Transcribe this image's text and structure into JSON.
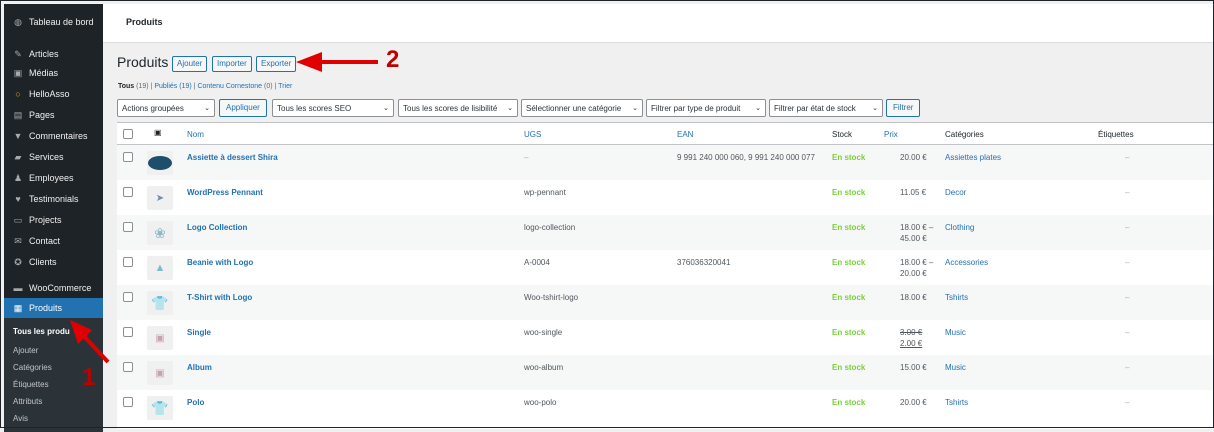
{
  "sidebar": {
    "items": [
      {
        "label": "Tableau de bord",
        "icon": "dashboard-icon"
      },
      {
        "label": "Articles",
        "icon": "pin-icon"
      },
      {
        "label": "Médias",
        "icon": "media-icon"
      },
      {
        "label": "HelloAsso",
        "icon": "helloasso-icon"
      },
      {
        "label": "Pages",
        "icon": "pages-icon"
      },
      {
        "label": "Commentaires",
        "icon": "comments-icon"
      },
      {
        "label": "Services",
        "icon": "services-icon"
      },
      {
        "label": "Employees",
        "icon": "employees-icon"
      },
      {
        "label": "Testimonials",
        "icon": "heart-icon"
      },
      {
        "label": "Projects",
        "icon": "projects-icon"
      },
      {
        "label": "Contact",
        "icon": "mail-icon"
      },
      {
        "label": "Clients",
        "icon": "clients-icon"
      },
      {
        "label": "WooCommerce",
        "icon": "woocommerce-icon"
      },
      {
        "label": "Produits",
        "icon": "archive-icon"
      }
    ],
    "submenu": [
      {
        "label": "Tous les produ"
      },
      {
        "label": "Ajouter"
      },
      {
        "label": "Catégories"
      },
      {
        "label": "Étiquettes"
      },
      {
        "label": "Attributs"
      },
      {
        "label": "Avis"
      }
    ]
  },
  "topbar": {
    "title": "Produits"
  },
  "heading": {
    "title": "Produits",
    "add_label": "Ajouter",
    "import_label": "Importer",
    "export_label": "Exporter"
  },
  "views": {
    "all": "Tous",
    "all_count": "(19)",
    "sep1": "|",
    "published": "Publiés (19)",
    "sep2": "|",
    "cornerstone": "Contenu Cornestone",
    "cornerstone_count": "(0)",
    "sep3": "|",
    "sort": "Trier"
  },
  "filters": {
    "bulk_actions": "Actions groupées",
    "apply": "Appliquer",
    "seo": "Tous les scores SEO",
    "readability": "Tous les scores de lisibilité",
    "category": "Sélectionner une catégorie",
    "product_type": "Filtrer par type de produit",
    "stock_status": "Filtrer par état de stock",
    "filter_button": "Filtrer"
  },
  "table": {
    "columns": {
      "name": "Nom",
      "sku": "UGS",
      "ean": "EAN",
      "stock": "Stock",
      "price": "Prix",
      "categories": "Catégories",
      "tags": "Étiquettes"
    },
    "rows": [
      {
        "name": "Assiette à dessert Shira",
        "sku": "–",
        "ean": "9 991 240 000 060, 9 991 240 000 077",
        "stock": "En stock",
        "price": "20.00 €",
        "price2": "",
        "category": "Assiettes plates",
        "tags": "–",
        "thumb": "plate-thumbnail"
      },
      {
        "name": "WordPress Pennant",
        "sku": "wp-pennant",
        "ean": "",
        "stock": "En stock",
        "price": "11.05 €",
        "price2": "",
        "category": "Decor",
        "tags": "–",
        "thumb": "pennant-thumbnail"
      },
      {
        "name": "Logo Collection",
        "sku": "logo-collection",
        "ean": "",
        "stock": "En stock",
        "price": "18.00 € –",
        "price2": "45.00 €",
        "category": "Clothing",
        "tags": "–",
        "thumb": "logo-collection-thumbnail"
      },
      {
        "name": "Beanie with Logo",
        "sku": "A-0004",
        "ean": "376036320041",
        "stock": "En stock",
        "price": "18.00 € –",
        "price2": "20.00 €",
        "category": "Accessories",
        "tags": "–",
        "thumb": "beanie-thumbnail"
      },
      {
        "name": "T-Shirt with Logo",
        "sku": "Woo-tshirt-logo",
        "ean": "",
        "stock": "En stock",
        "price": "18.00 €",
        "price2": "",
        "category": "Tshirts",
        "tags": "–",
        "thumb": "tshirt-thumbnail"
      },
      {
        "name": "Single",
        "sku": "woo-single",
        "ean": "",
        "stock": "En stock",
        "price": "3.00 €",
        "price2": "2.00 €",
        "category": "Music",
        "tags": "–",
        "thumb": "single-thumbnail"
      },
      {
        "name": "Album",
        "sku": "woo-album",
        "ean": "",
        "stock": "En stock",
        "price": "15.00 €",
        "price2": "",
        "category": "Music",
        "tags": "–",
        "thumb": "album-thumbnail"
      },
      {
        "name": "Polo",
        "sku": "woo-polo",
        "ean": "",
        "stock": "En stock",
        "price": "20.00 €",
        "price2": "",
        "category": "Tshirts",
        "tags": "–",
        "thumb": "polo-thumbnail"
      }
    ]
  },
  "annotations": {
    "arrow1_number": "1",
    "arrow2_number": "2",
    "color": "#e00000"
  },
  "colors": {
    "sidebar_bg": "#1d2327",
    "accent": "#2271b1",
    "in_stock": "#7ad03a"
  }
}
